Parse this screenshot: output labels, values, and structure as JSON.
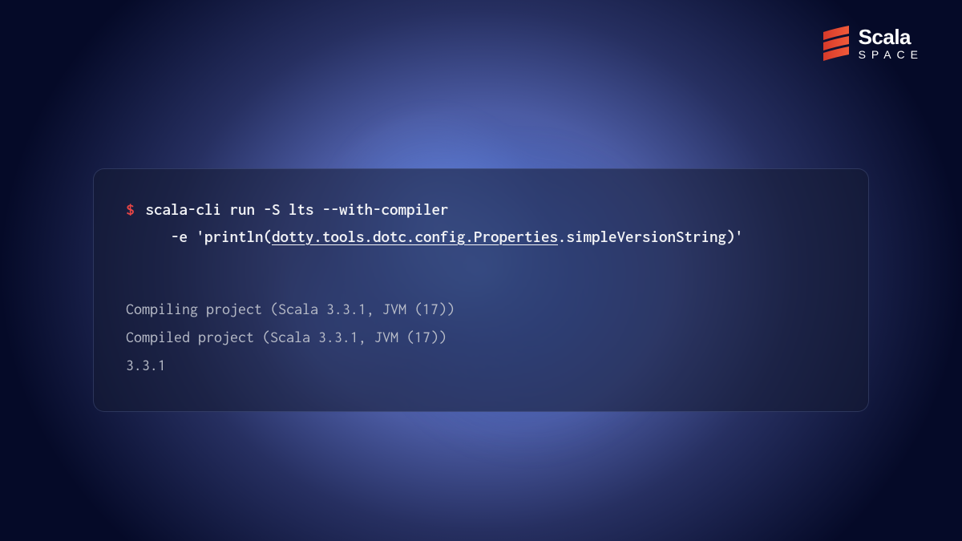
{
  "brand": {
    "name": "Scala",
    "sub": "SPACE"
  },
  "terminal": {
    "prompt": "$",
    "cmd": {
      "line1": "scala-cli run -S lts --with-compiler",
      "line2_prefix": "-e 'println(",
      "line2_underlined": "dotty.tools.dotc.config.Properties",
      "line2_suffix": ".simpleVersionString)'"
    },
    "output": {
      "l1": "Compiling project (Scala 3.3.1, JVM (17))",
      "l2": "Compiled project (Scala 3.3.1, JVM (17))",
      "l3": "3.3.1"
    }
  }
}
